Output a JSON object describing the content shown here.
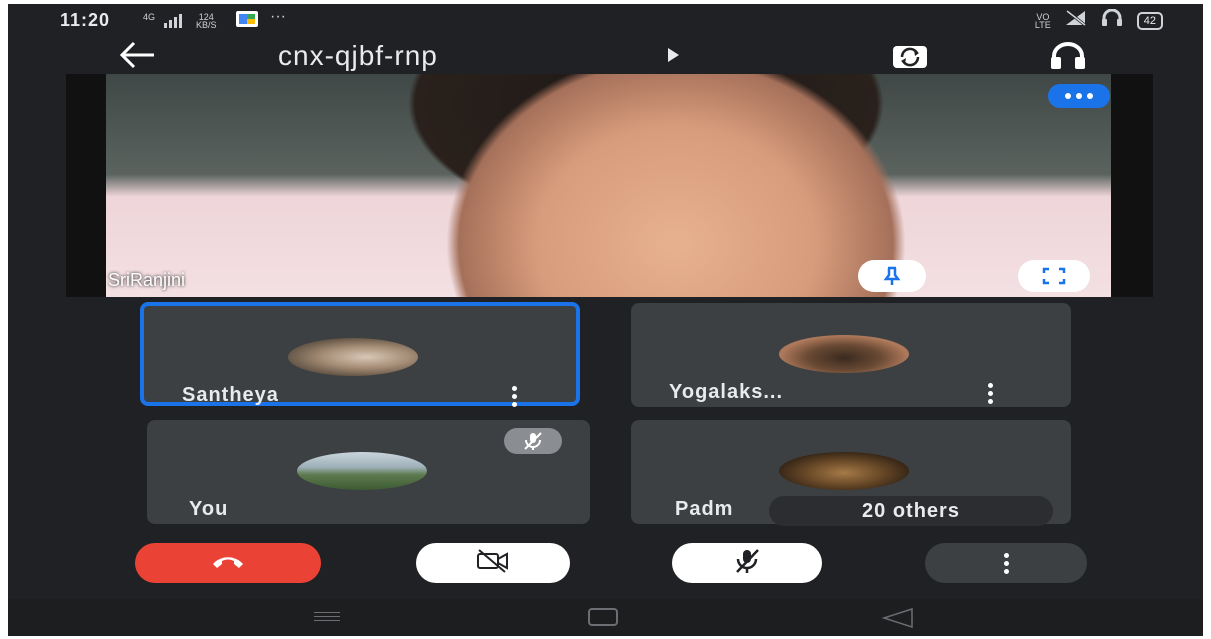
{
  "status_bar": {
    "time": "11:20",
    "signal_text": "4G",
    "speed_value": "124",
    "speed_unit": "KB/S",
    "more_notifications": "···",
    "network_label_top": "VO",
    "network_label_bottom": "LTE",
    "battery": "42"
  },
  "header": {
    "meeting_code": "cnx-qjbf-rnp"
  },
  "main_video": {
    "participant_name": "SriRanjini"
  },
  "participants": [
    {
      "name": "Santheya",
      "active_speaker": true
    },
    {
      "name": "Yogalaks...",
      "active_speaker": false
    },
    {
      "name": "You",
      "muted": true
    },
    {
      "name": "Padm",
      "others_label": "20 others"
    }
  ],
  "colors": {
    "background": "#202124",
    "tile": "#3c4043",
    "accent": "#1a73e8",
    "hangup": "#ea4335"
  },
  "icons": {
    "back": "arrow-left-icon",
    "switch_camera": "switch-camera-icon",
    "audio": "headphones-icon",
    "pin": "pin-icon",
    "fullscreen": "fullscreen-icon",
    "hangup": "phone-hangup-icon",
    "camera_off": "video-off-icon",
    "mic_off": "mic-off-icon",
    "more": "more-vertical-icon"
  }
}
